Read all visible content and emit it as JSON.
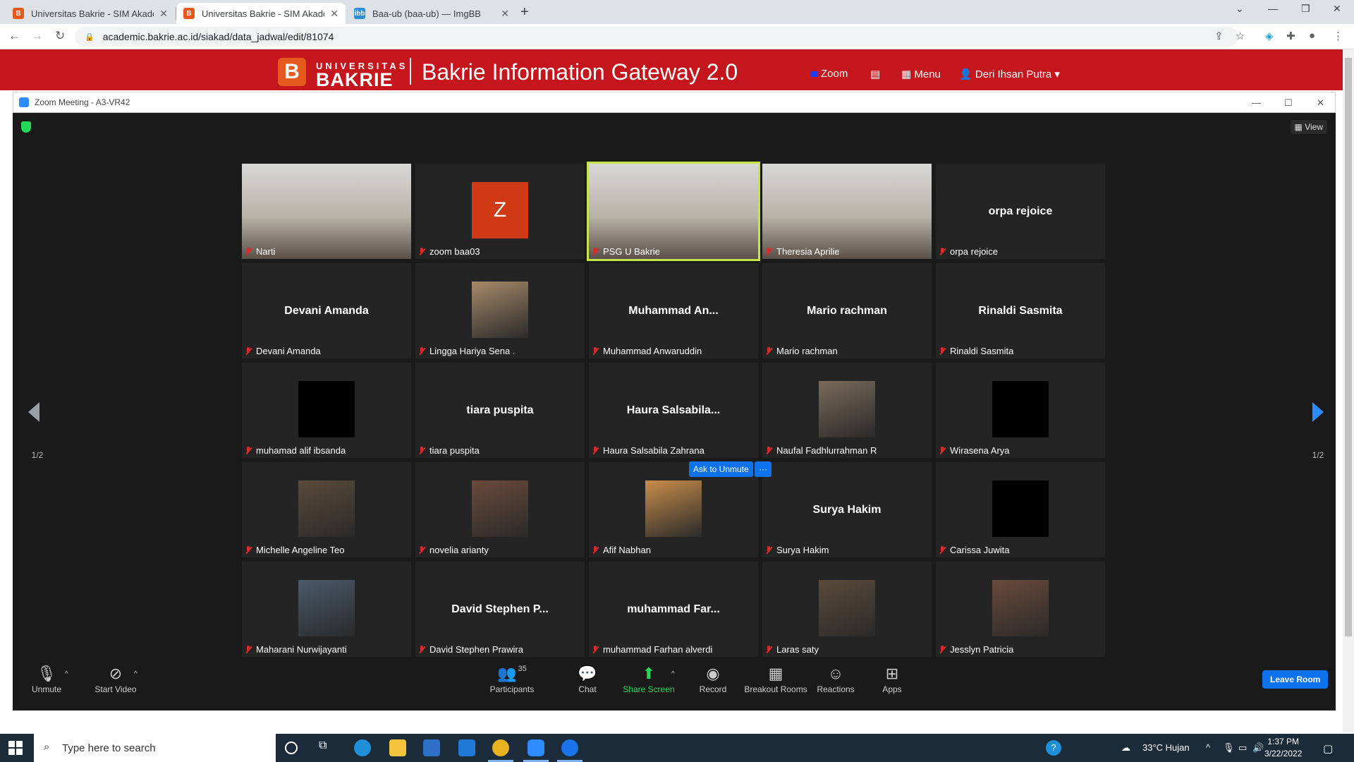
{
  "browser": {
    "tabs": [
      {
        "title": "Universitas Bakrie - SIM Akadem",
        "active": false
      },
      {
        "title": "Universitas Bakrie - SIM Akadem",
        "active": true
      },
      {
        "title": "Baa-ub (baa-ub) — ImgBB",
        "active": false
      }
    ],
    "url": "academic.bakrie.ac.id/siakad/data_jadwal/edit/81074"
  },
  "site": {
    "logo_letter": "B",
    "logo_top": "UNIVERSITAS",
    "logo_bottom": "BAKRIE",
    "title": "Bakrie Information Gateway 2.0",
    "nav_zoom": "Zoom",
    "nav_menu": "Menu",
    "user": "Deri Ihsan Putra"
  },
  "zoom": {
    "window_title": "Zoom Meeting - A3-VR42",
    "view_label": "View",
    "page_indicator": "1/2",
    "ask_unmute": "Ask to Unmute",
    "more": "···",
    "participants": [
      {
        "name": "Narti",
        "type": "video",
        "speaker": false
      },
      {
        "name": "zoom baa03",
        "type": "letter",
        "letter": "Z",
        "speaker": false
      },
      {
        "name": "PSG U Bakrie",
        "type": "video",
        "speaker": true
      },
      {
        "name": "Theresia Aprilie",
        "type": "video",
        "speaker": false
      },
      {
        "name": "orpa rejoice",
        "type": "name",
        "display": "orpa rejoice",
        "speaker": false
      },
      {
        "name": "Devani Amanda",
        "type": "name",
        "display": "Devani Amanda",
        "speaker": false
      },
      {
        "name": "Lingga Hariya Sena .",
        "type": "avatar",
        "speaker": false
      },
      {
        "name": "Muhammad Anwaruddin",
        "type": "name",
        "display": "Muhammad  An...",
        "speaker": false
      },
      {
        "name": "Mario rachman",
        "type": "name",
        "display": "Mario rachman",
        "speaker": false
      },
      {
        "name": "Rinaldi Sasmita",
        "type": "name",
        "display": "Rinaldi Sasmita",
        "speaker": false
      },
      {
        "name": "muhamad alif ibsanda",
        "type": "black",
        "speaker": false
      },
      {
        "name": "tiara puspita",
        "type": "name",
        "display": "tiara puspita",
        "speaker": false
      },
      {
        "name": "Haura Salsabila Zahrana",
        "type": "name",
        "display": "Haura  Salsabila...",
        "speaker": false
      },
      {
        "name": "Naufal Fadhlurrahman R",
        "type": "avatar",
        "speaker": false
      },
      {
        "name": "Wirasena Arya",
        "type": "black",
        "speaker": false
      },
      {
        "name": "Michelle Angeline Teo",
        "type": "avatar",
        "speaker": false
      },
      {
        "name": "novelia arianty",
        "type": "avatar",
        "speaker": false
      },
      {
        "name": "Afif Nabhan",
        "type": "avatar",
        "speaker": false
      },
      {
        "name": "Surya Hakim",
        "type": "name",
        "display": "Surya Hakim",
        "speaker": false
      },
      {
        "name": "Carissa Juwita",
        "type": "black",
        "speaker": false
      },
      {
        "name": "Maharani Nurwijayanti",
        "type": "avatar",
        "speaker": false
      },
      {
        "name": "David Stephen Prawira",
        "type": "name",
        "display": "David  Stephen  P...",
        "speaker": false
      },
      {
        "name": "muhammad Farhan alverdi",
        "type": "name",
        "display": "muhammad  Far...",
        "speaker": false
      },
      {
        "name": "Laras saty",
        "type": "avatar",
        "speaker": false
      },
      {
        "name": "Jesslyn Patricia",
        "type": "avatar",
        "speaker": false
      }
    ],
    "toolbar": {
      "unmute": "Unmute",
      "start_video": "Start Video",
      "participants": "Participants",
      "participant_count": "35",
      "chat": "Chat",
      "share_screen": "Share Screen",
      "record": "Record",
      "breakout_rooms": "Breakout Rooms",
      "reactions": "Reactions",
      "apps": "Apps",
      "leave": "Leave Room"
    }
  },
  "taskbar": {
    "search_placeholder": "Type here to search",
    "weather": "33°C  Hujan",
    "time": "1:37 PM",
    "date": "3/22/2022"
  },
  "colors": {
    "brand_red": "#c4161c",
    "zoom_blue": "#0e72ed",
    "speaker_outline": "#c7e34b",
    "share_green": "#23d959"
  }
}
